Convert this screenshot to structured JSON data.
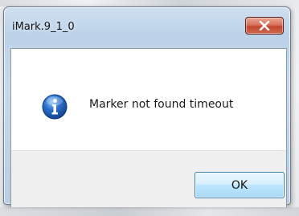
{
  "window": {
    "title": "iMark.9_1_0"
  },
  "dialog": {
    "message": "Marker not found timeout",
    "ok_label": "OK"
  },
  "icons": {
    "close": "close-icon",
    "info": "info-icon"
  },
  "colors": {
    "title_bar": "#bcd2e8",
    "close_button": "#c2462c",
    "info_icon": "#2a6fc9",
    "ok_button_border": "#3c7fb1",
    "footer_background": "#f0f0f0"
  }
}
